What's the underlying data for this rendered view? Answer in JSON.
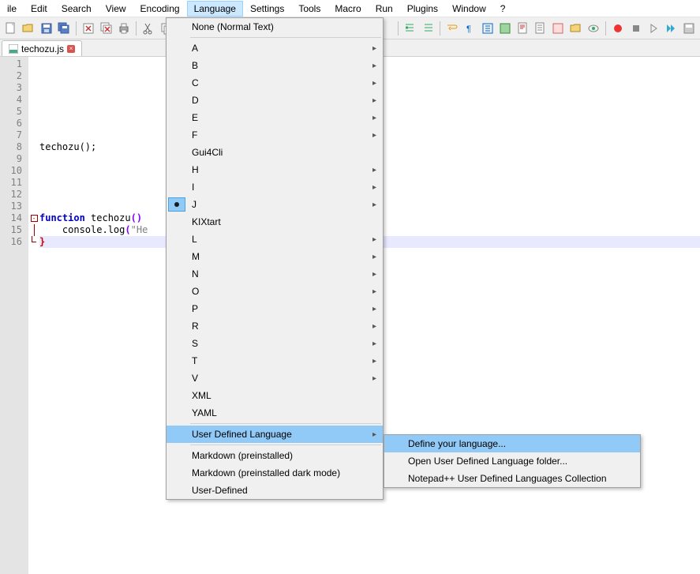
{
  "menubar": {
    "items": [
      {
        "label": "ile"
      },
      {
        "label": "Edit"
      },
      {
        "label": "Search"
      },
      {
        "label": "View"
      },
      {
        "label": "Encoding"
      },
      {
        "label": "Language",
        "active": true
      },
      {
        "label": "Settings"
      },
      {
        "label": "Tools"
      },
      {
        "label": "Macro"
      },
      {
        "label": "Run"
      },
      {
        "label": "Plugins"
      },
      {
        "label": "Window"
      },
      {
        "label": "?"
      }
    ]
  },
  "tab": {
    "filename": "techozu.js"
  },
  "gutter": {
    "lines": [
      "1",
      "2",
      "3",
      "4",
      "5",
      "6",
      "7",
      "8",
      "9",
      "10",
      "11",
      "12",
      "13",
      "14",
      "15",
      "16"
    ]
  },
  "code": {
    "l8": {
      "call": "techozu",
      "paren": "();"
    },
    "l14": {
      "kw": "function",
      "name": " techozu",
      "paren": "()"
    },
    "l15": {
      "indent": "    ",
      "fn": "console.log",
      "paren": "(",
      "str": "\"He"
    },
    "l16": {
      "brace": "}"
    }
  },
  "language_menu": {
    "none": "None (Normal Text)",
    "letters": [
      "A",
      "B",
      "C",
      "D",
      "E",
      "F"
    ],
    "gui4cli": "Gui4Cli",
    "letters2": [
      "H",
      "I",
      "J"
    ],
    "kixtart": "KIXtart",
    "letters3": [
      "L",
      "M",
      "N",
      "O",
      "P",
      "R",
      "S",
      "T",
      "V"
    ],
    "xml": "XML",
    "yaml": "YAML",
    "udl": "User Defined Language",
    "md1": "Markdown (preinstalled)",
    "md2": "Markdown (preinstalled dark mode)",
    "userdef": "User-Defined"
  },
  "udl_submenu": {
    "define": "Define your language...",
    "folder": "Open User Defined Language folder...",
    "collection": "Notepad++ User Defined Languages Collection"
  }
}
